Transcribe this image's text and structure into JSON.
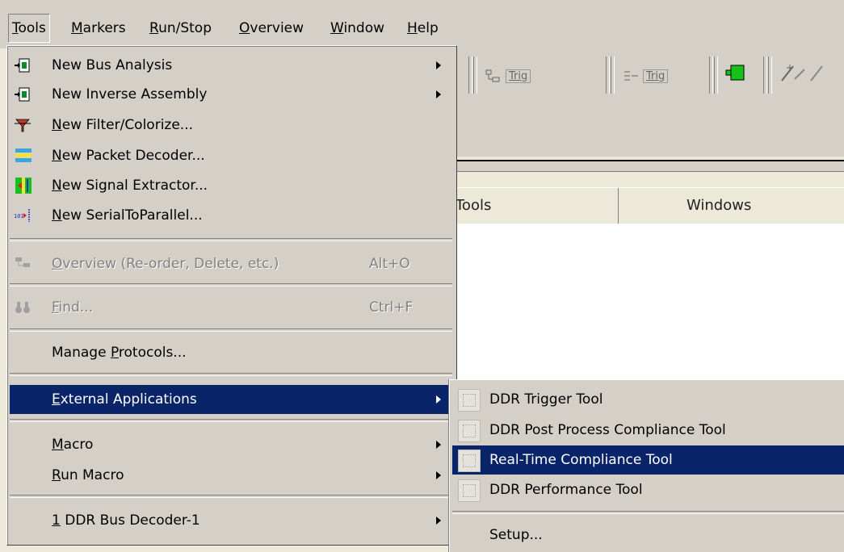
{
  "menubar": {
    "items": [
      {
        "accel": "T",
        "rest": "ools"
      },
      {
        "accel": "M",
        "rest": "arkers"
      },
      {
        "accel": "R",
        "rest": "un/Stop"
      },
      {
        "accel": "O",
        "rest": "verview"
      },
      {
        "accel": "W",
        "rest": "indow"
      },
      {
        "accel": "H",
        "rest": "elp"
      }
    ]
  },
  "toolbar": {
    "trig1": "Trig",
    "trig2": "Trig"
  },
  "table": {
    "col_tools": "Tools",
    "col_windows": "Windows"
  },
  "tools_menu": {
    "items": [
      {
        "pre": "New Bus Analysis",
        "accel": "",
        "post": ""
      },
      {
        "pre": "New Inverse Assembly",
        "accel": "",
        "post": ""
      },
      {
        "pre": "",
        "accel": "N",
        "post": "ew Filter/Colorize..."
      },
      {
        "pre": "",
        "accel": "N",
        "post": "ew Packet Decoder..."
      },
      {
        "pre": "",
        "accel": "N",
        "post": "ew Signal Extractor..."
      },
      {
        "pre": "",
        "accel": "N",
        "post": "ew SerialToParallel..."
      },
      {
        "pre": "",
        "accel": "O",
        "post": "verview (Re-order, Delete, etc.)",
        "shortcut": "Alt+O"
      },
      {
        "pre": "",
        "accel": "F",
        "post": "ind...",
        "shortcut": "Ctrl+F"
      },
      {
        "pre": "Manage ",
        "accel": "P",
        "post": "rotocols..."
      },
      {
        "pre": "",
        "accel": "E",
        "post": "xternal Applications"
      },
      {
        "pre": "",
        "accel": "M",
        "post": "acro"
      },
      {
        "pre": "",
        "accel": "R",
        "post": "un Macro"
      },
      {
        "pre": "",
        "accel": "1",
        "post": " DDR Bus Decoder-1"
      }
    ]
  },
  "ext_menu": {
    "items": [
      "DDR Trigger Tool",
      "DDR Post Process Compliance Tool",
      "Real-Time Compliance Tool",
      "DDR Performance Tool"
    ],
    "setup": "Setup..."
  },
  "colors": {
    "highlight": "#0a246a",
    "menu_bg": "#d4d0c8"
  }
}
